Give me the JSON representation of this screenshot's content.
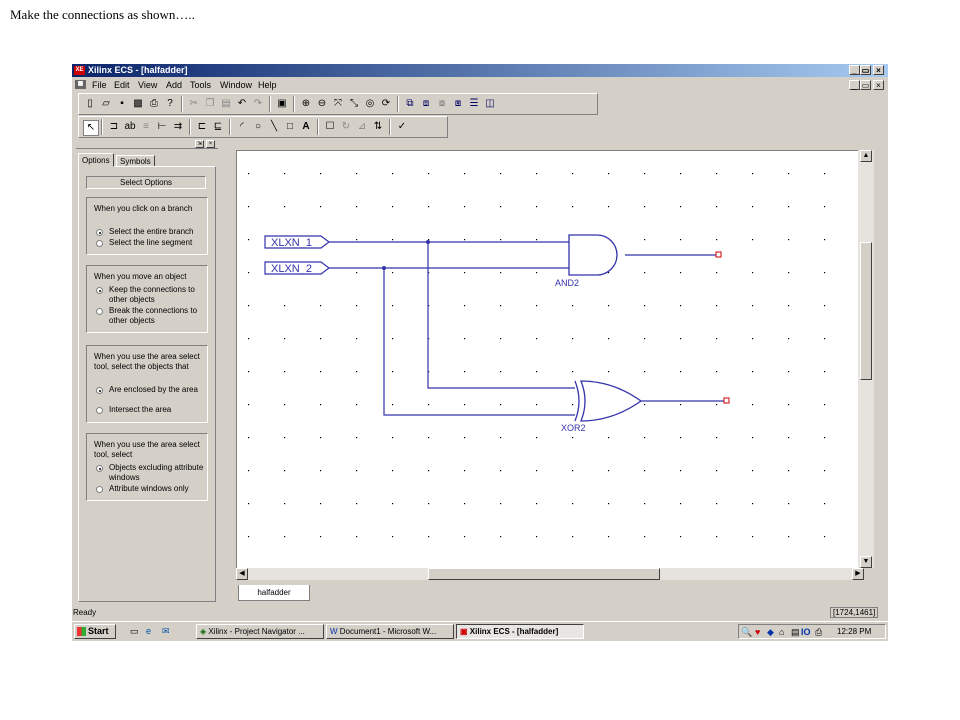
{
  "caption": "Make the connections as shown…..",
  "window": {
    "title": "Xilinx ECS - [halfadder]",
    "app_icon": "XE"
  },
  "menu": [
    "File",
    "Edit",
    "View",
    "Add",
    "Tools",
    "Window",
    "Help"
  ],
  "left_panel": {
    "tabs": [
      "Options",
      "Symbols"
    ],
    "select_options": "Select Options",
    "groups": [
      {
        "question": "When you click on a branch",
        "options": [
          {
            "label": "Select the entire branch",
            "selected": true
          },
          {
            "label": "Select the line segment",
            "selected": false
          }
        ]
      },
      {
        "question": "When you move an object",
        "options": [
          {
            "label": "Keep the connections to other objects",
            "selected": true
          },
          {
            "label": "Break the connections to other objects",
            "selected": false
          }
        ]
      },
      {
        "question": "When you use the area select tool, select the objects that",
        "options": [
          {
            "label": "Are enclosed by the area",
            "selected": true
          },
          {
            "label": "Intersect the area",
            "selected": false
          }
        ]
      },
      {
        "question": "When you use the area select tool, select",
        "options": [
          {
            "label": "Objects excluding attribute windows",
            "selected": true
          },
          {
            "label": "Attribute windows only",
            "selected": false
          }
        ]
      }
    ]
  },
  "schematic": {
    "inputs": [
      "XLXN_1",
      "XLXN_2"
    ],
    "gates": [
      "AND2",
      "XOR2"
    ],
    "colors": {
      "wire": "#3333aa",
      "terminal": "#cc0000",
      "grid": "#000000"
    }
  },
  "doc_tab": "halfadder",
  "status": {
    "left": "Ready",
    "coords": "[1724,1461]"
  },
  "taskbar": {
    "start": "Start",
    "tasks": [
      "Xilinx - Project Navigator ...",
      "Document1 - Microsoft W...",
      "Xilinx ECS - [halfadder]"
    ],
    "clock": "12:28 PM",
    "tray_text": "IO"
  }
}
